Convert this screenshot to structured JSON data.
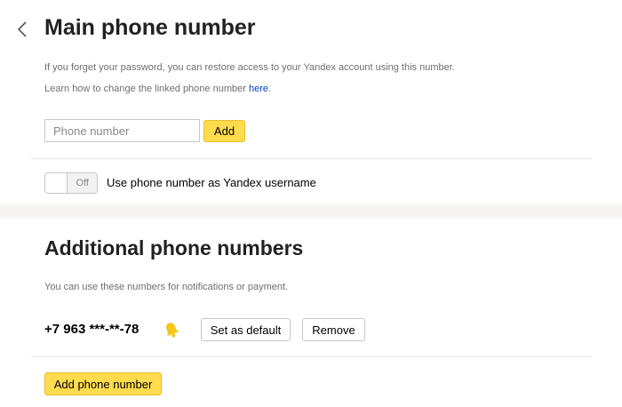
{
  "main": {
    "title": "Main phone number",
    "desc1": "If you forget your password, you can restore access to your Yandex account using this number.",
    "desc2_prefix": "Learn how to change the linked phone number ",
    "desc2_link": "here",
    "desc2_suffix": ".",
    "phone_input": {
      "value": "",
      "placeholder": "Phone number"
    },
    "add_label": "Add",
    "toggle": {
      "state_label": "Off",
      "is_on": false,
      "label": "Use phone number as Yandex username"
    }
  },
  "additional": {
    "title": "Additional phone numbers",
    "desc": "You can use these numbers for notifications or payment.",
    "phones": [
      {
        "number": "+7 963 ***-**-78",
        "set_default_label": "Set as default",
        "remove_label": "Remove"
      }
    ],
    "add_phone_label": "Add phone number"
  },
  "colors": {
    "accent_yellow": "#ffdb4d",
    "link_blue": "#0044bb",
    "bell_yellow": "#f5c518"
  },
  "icons": {
    "back": "chevron-left-icon",
    "notification": "bell-icon"
  }
}
